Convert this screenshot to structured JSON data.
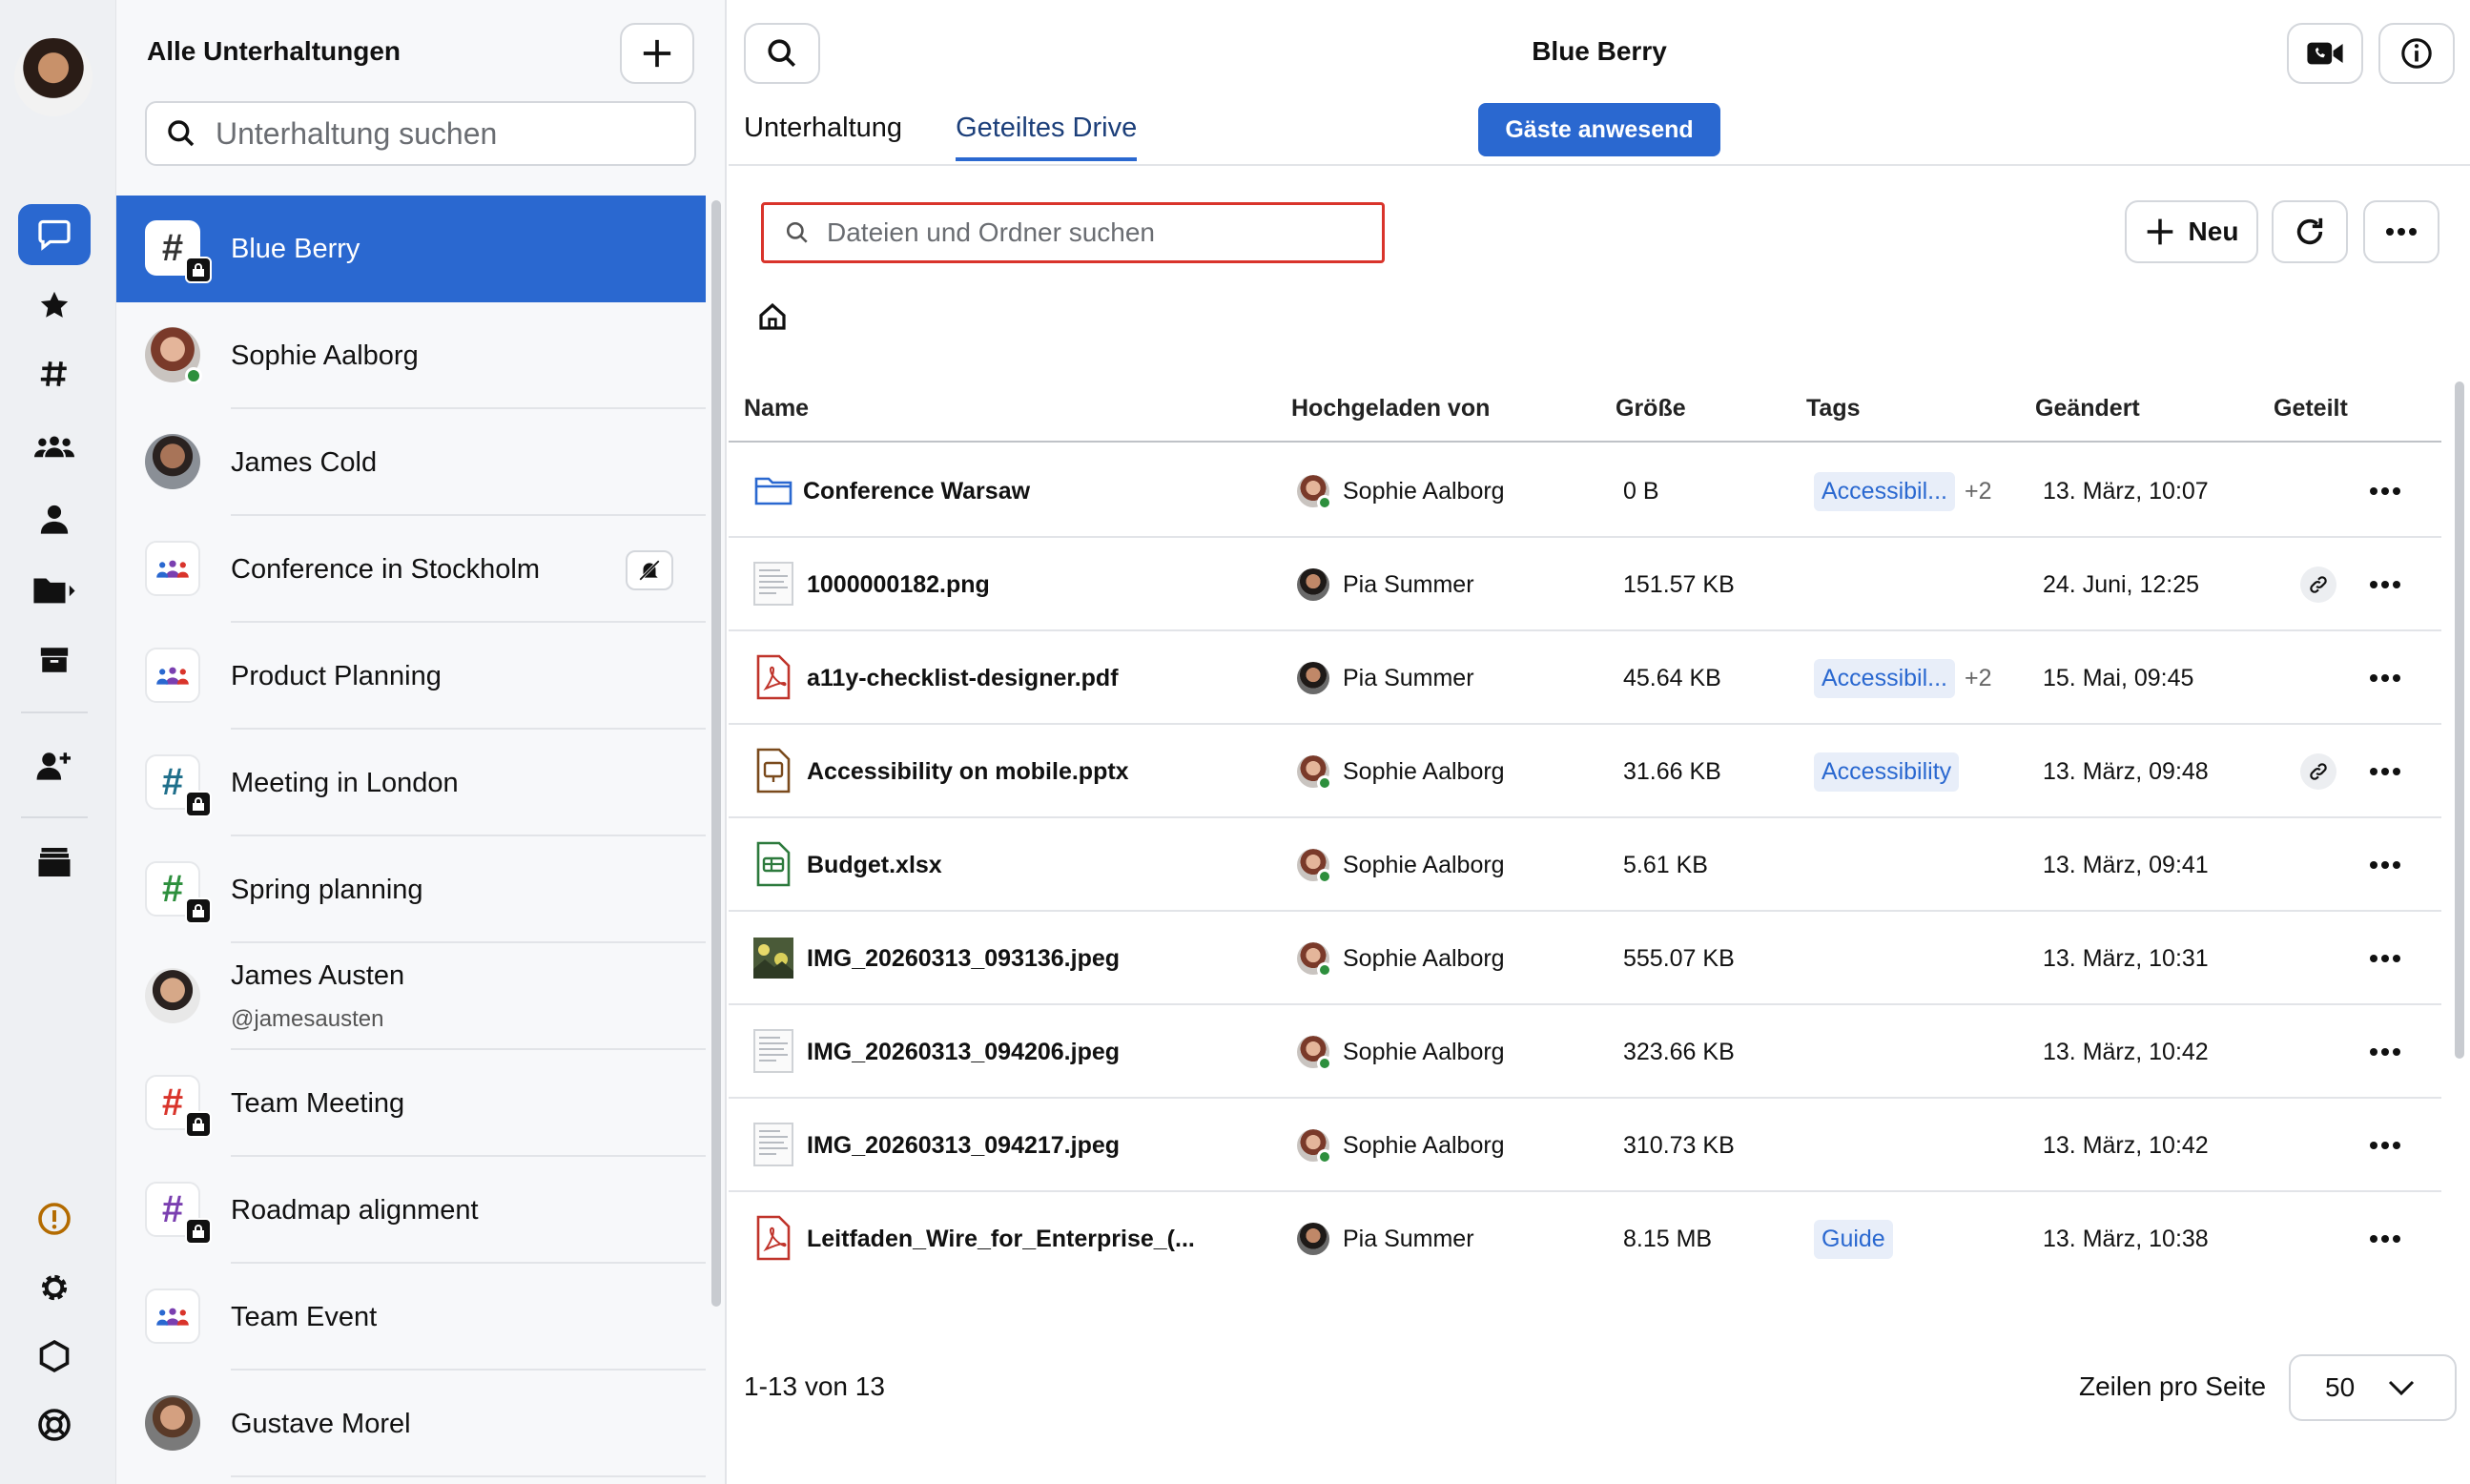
{
  "rail": {
    "items": [
      {
        "name": "conversations",
        "icon": "chat-bubble-icon",
        "active": true
      },
      {
        "name": "favorites",
        "icon": "star-icon"
      },
      {
        "name": "groups",
        "icon": "hash-icon"
      },
      {
        "name": "channels",
        "icon": "people-icon"
      },
      {
        "name": "contacts",
        "icon": "person-icon"
      },
      {
        "name": "folders",
        "icon": "folder-icon"
      },
      {
        "name": "archive",
        "icon": "archive-icon"
      },
      {
        "name": "connect",
        "icon": "add-person-icon"
      },
      {
        "name": "cells",
        "icon": "drawer-icon"
      }
    ],
    "bottom": [
      "alert-icon",
      "gear-icon",
      "hexagon-icon",
      "lifebuoy-icon"
    ]
  },
  "conversations": {
    "title": "Alle Unterhaltungen",
    "search_placeholder": "Unterhaltung suchen",
    "items": [
      {
        "name": "Blue Berry",
        "type": "group-locked",
        "color": "#333333",
        "active": true
      },
      {
        "name": "Sophie Aalborg",
        "type": "photo",
        "online": true
      },
      {
        "name": "James Cold",
        "type": "photo"
      },
      {
        "name": "Conference in Stockholm",
        "type": "people",
        "muted": true
      },
      {
        "name": "Product Planning",
        "type": "people"
      },
      {
        "name": "Meeting in London",
        "type": "group-locked",
        "color": "#1f6f8b"
      },
      {
        "name": "Spring planning",
        "type": "group-locked",
        "color": "#2d8f3d"
      },
      {
        "name": "James Austen",
        "sub": "@jamesausten",
        "type": "photo"
      },
      {
        "name": "Team Meeting",
        "type": "group-locked",
        "color": "#d9342b"
      },
      {
        "name": "Roadmap alignment",
        "type": "group-locked",
        "color": "#7a3fb0"
      },
      {
        "name": "Team Event",
        "type": "people"
      },
      {
        "name": "Gustave Morel",
        "type": "photo"
      }
    ]
  },
  "header": {
    "title": "Blue Berry",
    "tabs": [
      "Unterhaltung",
      "Geteiltes Drive"
    ],
    "active_tab": "Geteiltes Drive",
    "guests_badge": "Gäste anwesend"
  },
  "drive": {
    "search_placeholder": "Dateien und Ordner suchen",
    "new_label": "Neu",
    "columns": {
      "name": "Name",
      "uploaded_by": "Hochgeladen von",
      "size": "Größe",
      "tags": "Tags",
      "modified": "Geändert",
      "shared": "Geteilt"
    },
    "rows": [
      {
        "name": "Conference Warsaw",
        "kind": "folder",
        "user": "Sophie Aalborg",
        "online": true,
        "size": "0 B",
        "tag": "Accessibil...",
        "more": "+2",
        "modified": "13. März, 10:07",
        "shared": false
      },
      {
        "name": "1000000182.png",
        "kind": "image-doc",
        "user": "Pia Summer",
        "online": false,
        "size": "151.57 KB",
        "tag": "",
        "more": "",
        "modified": "24. Juni, 12:25",
        "shared": true
      },
      {
        "name": "a11y-checklist-designer.pdf",
        "kind": "pdf",
        "user": "Pia Summer",
        "online": false,
        "size": "45.64 KB",
        "tag": "Accessibil...",
        "more": "+2",
        "modified": "15. Mai, 09:45",
        "shared": false
      },
      {
        "name": "Accessibility on mobile.pptx",
        "kind": "pptx",
        "user": "Sophie Aalborg",
        "online": true,
        "size": "31.66 KB",
        "tag": "Accessibility",
        "more": "",
        "modified": "13. März, 09:48",
        "shared": true
      },
      {
        "name": "Budget.xlsx",
        "kind": "xlsx",
        "user": "Sophie Aalborg",
        "online": true,
        "size": "5.61 KB",
        "tag": "",
        "more": "",
        "modified": "13. März, 09:41",
        "shared": false
      },
      {
        "name": "IMG_20260313_093136.jpeg",
        "kind": "photo",
        "user": "Sophie Aalborg",
        "online": true,
        "size": "555.07 KB",
        "tag": "",
        "more": "",
        "modified": "13. März, 10:31",
        "shared": false
      },
      {
        "name": "IMG_20260313_094206.jpeg",
        "kind": "image-doc",
        "user": "Sophie Aalborg",
        "online": true,
        "size": "323.66 KB",
        "tag": "",
        "more": "",
        "modified": "13. März, 10:42",
        "shared": false
      },
      {
        "name": "IMG_20260313_094217.jpeg",
        "kind": "image-doc",
        "user": "Sophie Aalborg",
        "online": true,
        "size": "310.73 KB",
        "tag": "",
        "more": "",
        "modified": "13. März, 10:42",
        "shared": false
      },
      {
        "name": "Leitfaden_Wire_for_Enterprise_(...",
        "kind": "pdf",
        "user": "Pia Summer",
        "online": false,
        "size": "8.15 MB",
        "tag": "Guide",
        "more": "",
        "modified": "13. März, 10:38",
        "shared": false
      }
    ],
    "pagination": {
      "count": "1-13 von 13",
      "rows_label": "Zeilen pro Seite",
      "rows_value": "50"
    }
  },
  "colors": {
    "accent": "#2a68d0",
    "online": "#2d8f3d",
    "pdf": "#c0342b",
    "pptx": "#7a4a1c",
    "xlsx": "#2d7a3d",
    "folder": "#2a68d0"
  }
}
